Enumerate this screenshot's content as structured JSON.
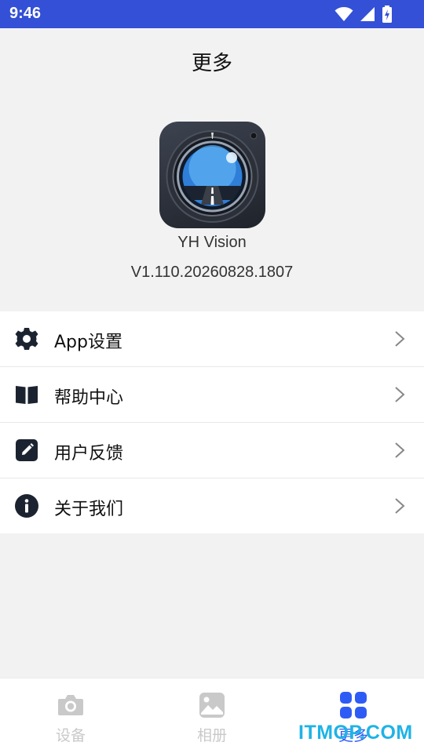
{
  "status_bar": {
    "time": "9:46",
    "background": "#3350d6",
    "icons": [
      "wifi-icon",
      "signal-icon",
      "battery-charging-icon"
    ]
  },
  "header": {
    "title": "更多"
  },
  "app_info": {
    "logo_icon": "camera-lens-road-icon",
    "name": "YH Vision",
    "version": "V1.110.20260828.1807"
  },
  "menu": {
    "items": [
      {
        "label": "App设置",
        "icon": "gear-icon"
      },
      {
        "label": "帮助中心",
        "icon": "book-icon"
      },
      {
        "label": "用户反馈",
        "icon": "edit-icon"
      },
      {
        "label": "关于我们",
        "icon": "info-icon"
      }
    ],
    "chevron_icon": "chevron-right-icon"
  },
  "bottom_nav": {
    "items": [
      {
        "label": "设备",
        "icon": "camera-icon",
        "active": false
      },
      {
        "label": "相册",
        "icon": "gallery-icon",
        "active": false
      },
      {
        "label": "更多",
        "icon": "grid-icon",
        "active": true
      }
    ],
    "inactive_color": "#c9c9c9",
    "active_color": "#2f5bf5"
  },
  "watermark": "ITMOP.COM"
}
